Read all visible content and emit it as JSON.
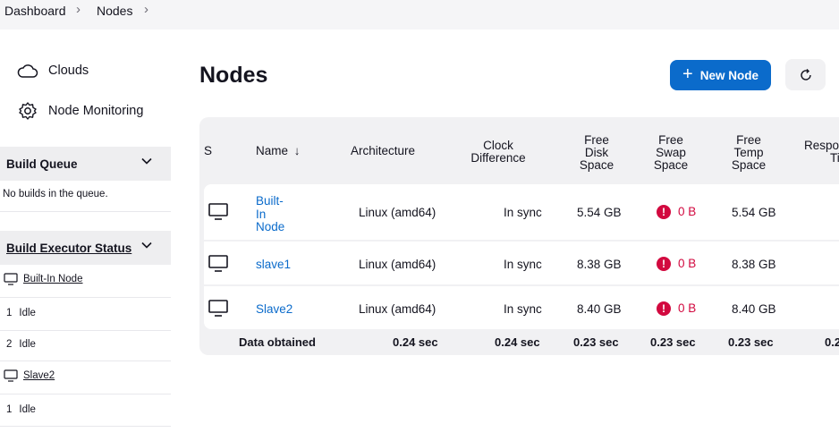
{
  "breadcrumb": {
    "items": [
      "Dashboard",
      "Nodes"
    ]
  },
  "sidebar": {
    "links": [
      {
        "label": "Clouds",
        "icon": "cloud-icon"
      },
      {
        "label": "Node Monitoring",
        "icon": "gear-icon"
      }
    ],
    "build_queue": {
      "title": "Build Queue",
      "empty_text": "No builds in the queue."
    },
    "executor_status": {
      "title": "Build Executor Status",
      "nodes": [
        {
          "name": "Built-In Node",
          "executors": [
            {
              "num": "1",
              "state": "Idle"
            },
            {
              "num": "2",
              "state": "Idle"
            }
          ]
        },
        {
          "name": "Slave2",
          "executors": [
            {
              "num": "1",
              "state": "Idle"
            }
          ]
        }
      ]
    }
  },
  "main": {
    "title": "Nodes",
    "new_node_label": "New Node",
    "table": {
      "headers": {
        "s": "S",
        "name": "Name",
        "name_sort": "↓",
        "arch": "Architecture",
        "clock": [
          "Clock",
          "Difference"
        ],
        "disk": [
          "Free",
          "Disk",
          "Space"
        ],
        "swap": [
          "Free",
          "Swap",
          "Space"
        ],
        "temp": [
          "Free",
          "Temp",
          "Space"
        ],
        "resp": [
          "Response",
          "Time"
        ]
      },
      "rows": [
        {
          "name_lines": [
            "Built-",
            "In",
            "Node"
          ],
          "arch": "Linux (amd64)",
          "clock": "In sync",
          "disk": "5.54 GB",
          "swap": "0 B",
          "temp": "5.54 GB"
        },
        {
          "name_lines": [
            "slave1"
          ],
          "arch": "Linux (amd64)",
          "clock": "In sync",
          "disk": "8.38 GB",
          "swap": "0 B",
          "temp": "8.38 GB"
        },
        {
          "name_lines": [
            "Slave2"
          ],
          "arch": "Linux (amd64)",
          "clock": "In sync",
          "disk": "8.40 GB",
          "swap": "0 B",
          "temp": "8.40 GB"
        }
      ],
      "footer": {
        "label": "Data obtained",
        "arch": "0.24 sec",
        "clock": "0.24 sec",
        "disk": "0.23 sec",
        "swap": "0.23 sec",
        "temp": "0.23 sec",
        "resp": "0.2"
      }
    }
  },
  "colors": {
    "accent": "#0b6bcb",
    "error": "#d2093f"
  }
}
